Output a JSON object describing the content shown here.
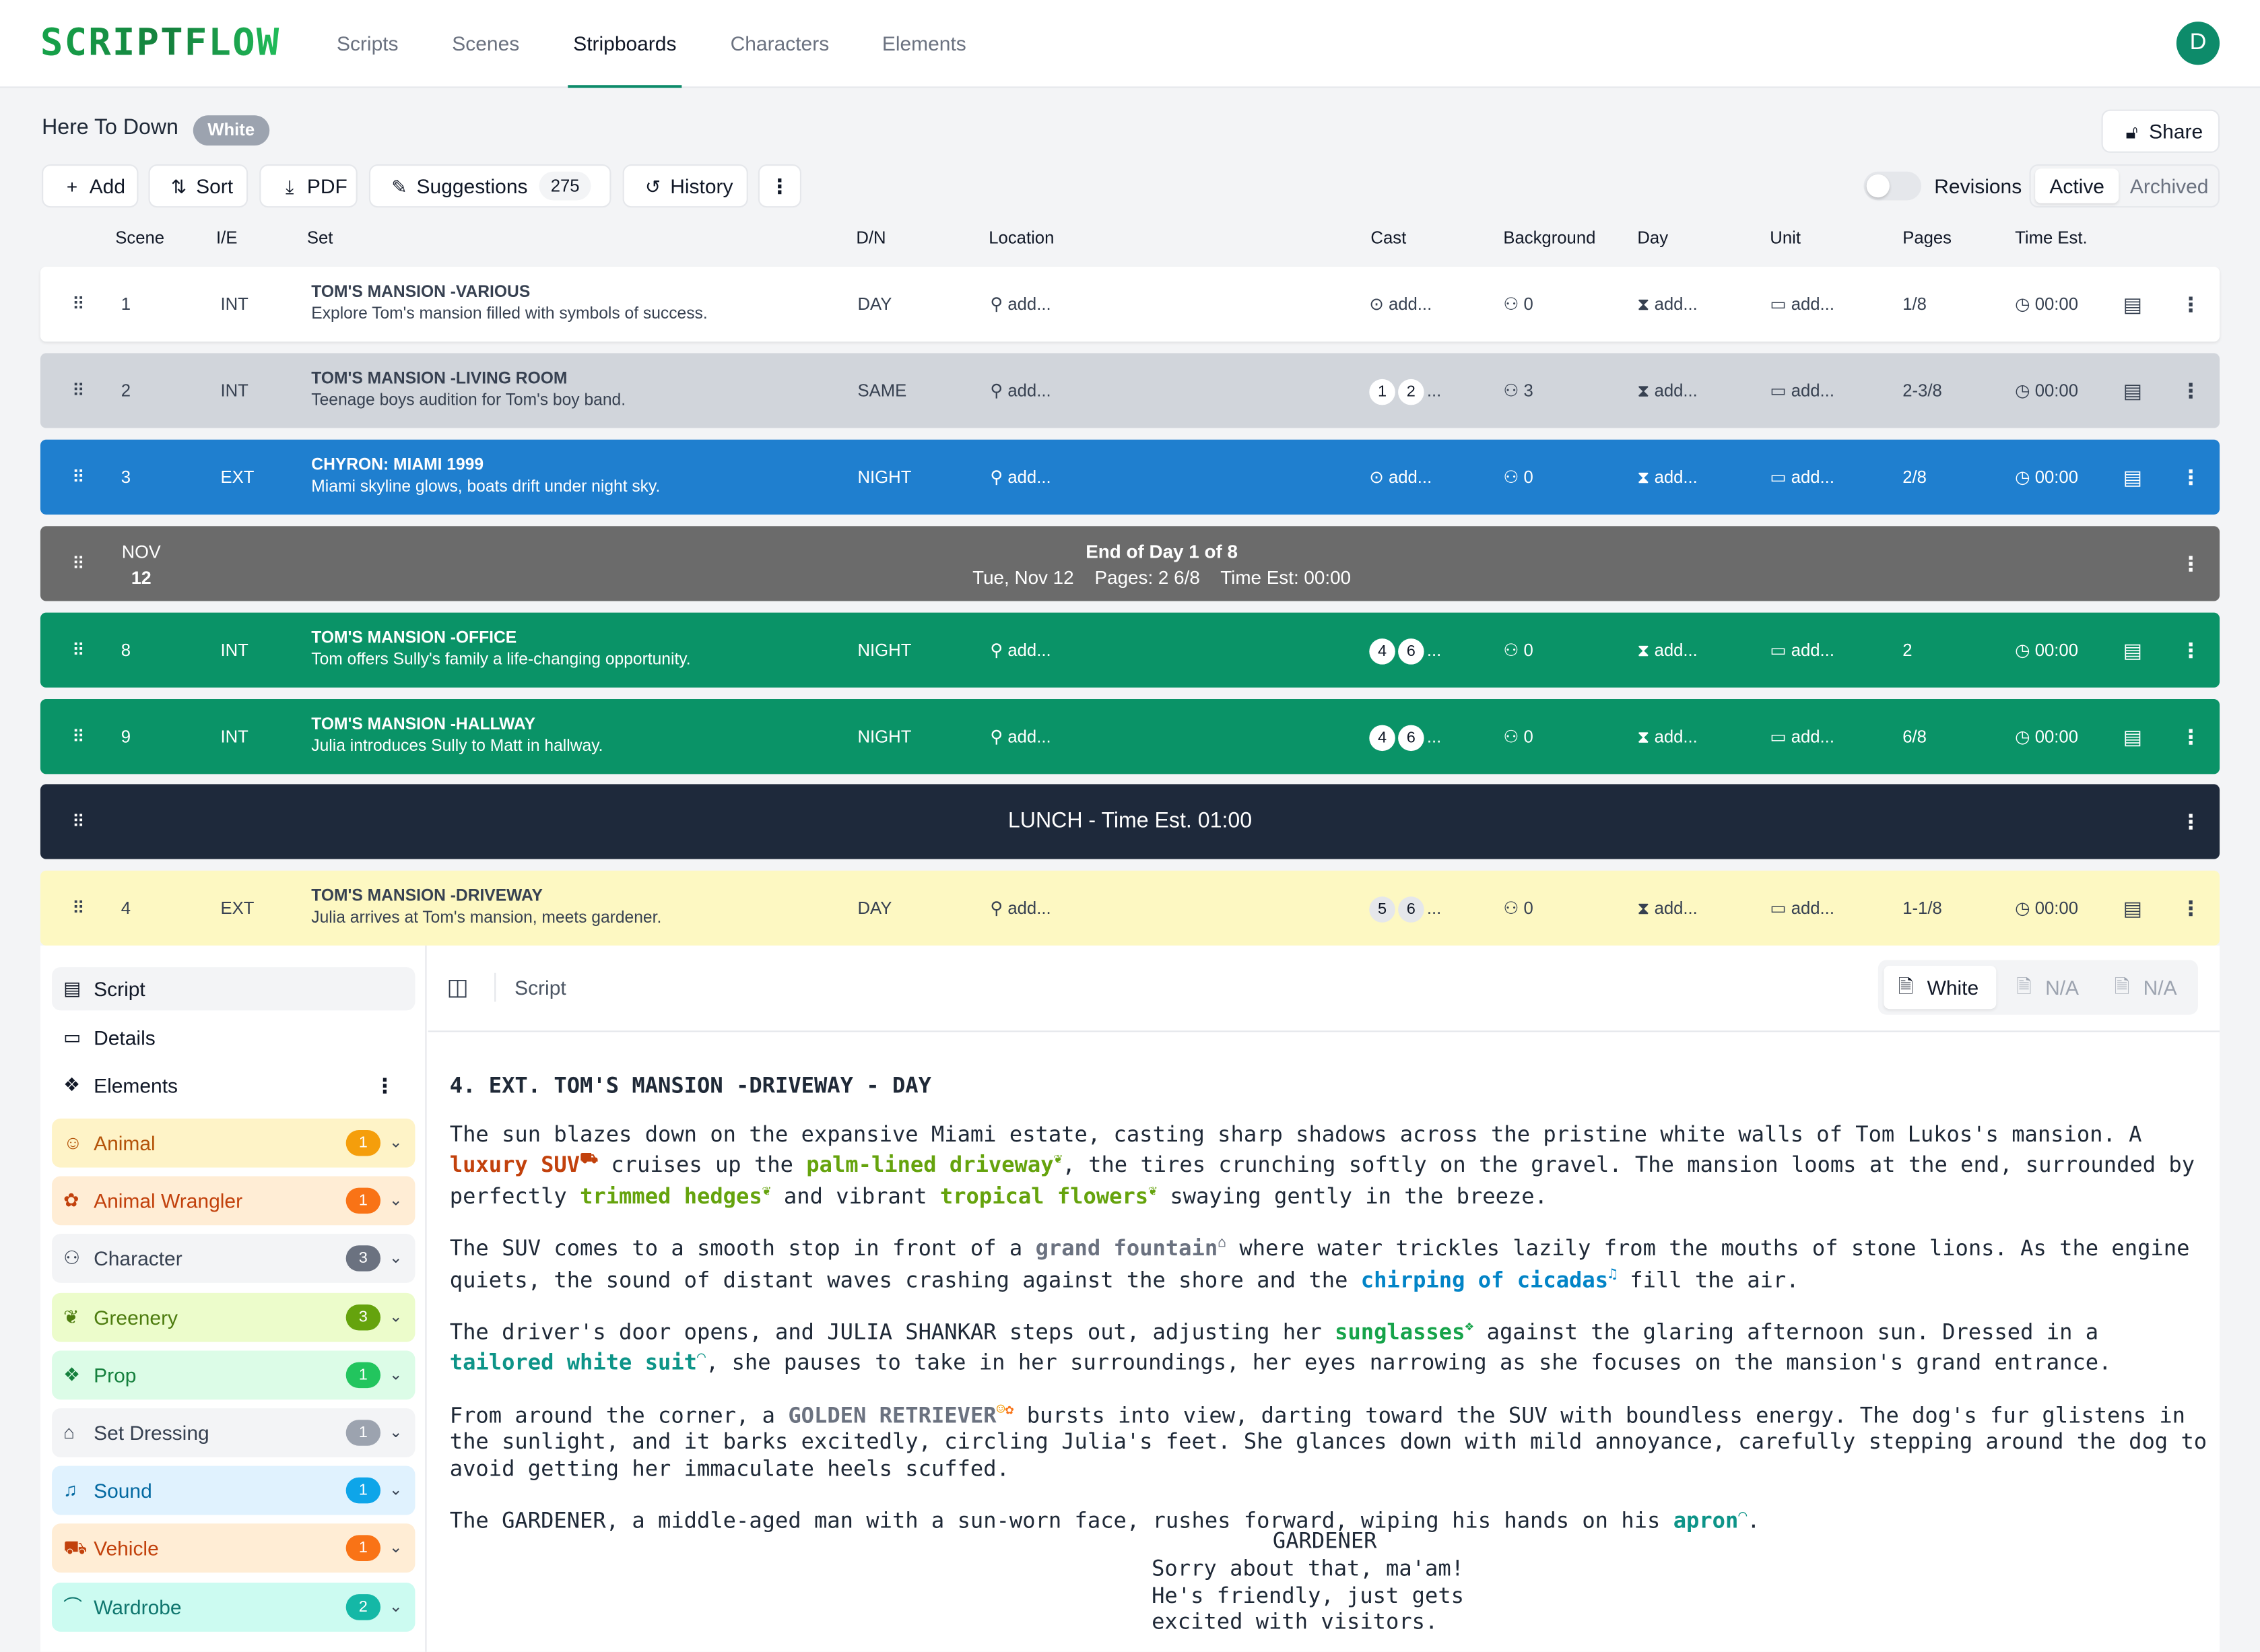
{
  "app": {
    "logo_text": "SCRIPTFLOW",
    "nav": [
      "Scripts",
      "Scenes",
      "Stripboards",
      "Characters",
      "Elements"
    ],
    "active_nav": "Stripboards",
    "avatar_initial": "D"
  },
  "doc": {
    "title": "Here To Down",
    "revision_badge": "White",
    "share_label": "Share"
  },
  "toolbar": {
    "add": "Add",
    "sort": "Sort",
    "pdf": "PDF",
    "suggestions": "Suggestions",
    "suggestions_count": "275",
    "history": "History",
    "revisions_label": "Revisions",
    "active": "Active",
    "archived": "Archived"
  },
  "columns": [
    "Scene",
    "I/E",
    "Set",
    "D/N",
    "Location",
    "Cast",
    "Background",
    "Day",
    "Unit",
    "Pages",
    "Time Est."
  ],
  "placeholders": {
    "location": "add...",
    "cast": "add...",
    "day": "add...",
    "unit": "add..."
  },
  "strips": [
    {
      "scene": "1",
      "ie": "INT",
      "set": "TOM'S MANSION -VARIOUS",
      "desc": "Explore Tom's mansion filled with symbols of success.",
      "dn": "DAY",
      "cast": [],
      "background": "0",
      "pages": "1/8",
      "time": "00:00",
      "color": "white"
    },
    {
      "scene": "2",
      "ie": "INT",
      "set": "TOM'S MANSION -LIVING ROOM",
      "desc": "Teenage boys audition for Tom's boy band.",
      "dn": "SAME",
      "cast": [
        "1",
        "2"
      ],
      "background": "3",
      "pages": "2-3/8",
      "time": "00:00",
      "color": "gray"
    },
    {
      "scene": "3",
      "ie": "EXT",
      "set": "CHYRON: MIAMI 1999",
      "desc": "Miami skyline glows, boats drift under night sky.",
      "dn": "NIGHT",
      "cast": [],
      "background": "0",
      "pages": "2/8",
      "time": "00:00",
      "color": "blue"
    },
    {
      "scene": "8",
      "ie": "INT",
      "set": "TOM'S MANSION -OFFICE",
      "desc": "Tom offers Sully's family a life-changing opportunity.",
      "dn": "NIGHT",
      "cast": [
        "4",
        "6"
      ],
      "background": "0",
      "pages": "2",
      "time": "00:00",
      "color": "green"
    },
    {
      "scene": "9",
      "ie": "INT",
      "set": "TOM'S MANSION -HALLWAY",
      "desc": "Julia introduces Sully to Matt in hallway.",
      "dn": "NIGHT",
      "cast": [
        "4",
        "6"
      ],
      "background": "0",
      "pages": "6/8",
      "time": "00:00",
      "color": "green"
    },
    {
      "scene": "4",
      "ie": "EXT",
      "set": "TOM'S MANSION -DRIVEWAY",
      "desc": "Julia arrives at Tom's mansion, meets gardener.",
      "dn": "DAY",
      "cast": [
        "5",
        "6"
      ],
      "background": "0",
      "pages": "1-1/8",
      "time": "00:00",
      "color": "yellow"
    }
  ],
  "day_break": {
    "month": "NOV",
    "day": "12",
    "title": "End of Day 1 of 8",
    "detail": "Tue, Nov 12    Pages: 2 6/8    Time Est: 00:00"
  },
  "lunch": {
    "label": "LUNCH - Time Est. 01:00"
  },
  "panel": {
    "tabs": [
      "Script",
      "Details",
      "Elements"
    ],
    "categories": [
      {
        "name": "Animal",
        "count": "1",
        "bg": "#fef3c7",
        "fg": "#b45309",
        "badge": "#f59e0b"
      },
      {
        "name": "Animal Wrangler",
        "count": "1",
        "bg": "#ffedd5",
        "fg": "#c2410c",
        "badge": "#f97316"
      },
      {
        "name": "Character",
        "count": "3",
        "bg": "#f3f4f6",
        "fg": "#374151",
        "badge": "#6b7280"
      },
      {
        "name": "Greenery",
        "count": "3",
        "bg": "#ecfccb",
        "fg": "#4d7c0f",
        "badge": "#65a30d"
      },
      {
        "name": "Prop",
        "count": "1",
        "bg": "#dcfce7",
        "fg": "#15803d",
        "badge": "#22c55e"
      },
      {
        "name": "Set Dressing",
        "count": "1",
        "bg": "#f3f4f6",
        "fg": "#374151",
        "badge": "#9ca3af"
      },
      {
        "name": "Sound",
        "count": "1",
        "bg": "#e0f2fe",
        "fg": "#0369a1",
        "badge": "#0ea5e9"
      },
      {
        "name": "Vehicle",
        "count": "1",
        "bg": "#ffedd5",
        "fg": "#c2410c",
        "badge": "#f97316"
      },
      {
        "name": "Wardrobe",
        "count": "2",
        "bg": "#ccfbf1",
        "fg": "#0f766e",
        "badge": "#14b8a6"
      }
    ],
    "script_label": "Script",
    "revisions": [
      "White",
      "N/A",
      "N/A"
    ]
  },
  "script": {
    "slug": "4. EXT. TOM'S MANSION -DRIVEWAY - DAY",
    "p1a": "The sun blazes down on the expansive Miami estate, casting sharp shadows across the pristine white walls of Tom Lukos's mansion. A ",
    "p1_el1": "luxury SUV",
    "p1b": " cruises up the ",
    "p1_el2": "palm-lined driveway",
    "p1c": ", the tires crunching softly on the gravel. The mansion looms at the end, surrounded by perfectly ",
    "p1_el3": "trimmed hedges",
    "p1d": " and vibrant ",
    "p1_el4": "tropical flowers",
    "p1e": " swaying gently in the breeze.",
    "p2a": "The SUV comes to a smooth stop in front of a ",
    "p2_el1": "grand fountain",
    "p2b": " where water trickles lazily from the mouths of stone lions. As the engine quiets, the sound of distant waves crashing against the shore and the ",
    "p2_el2": "chirping of cicadas",
    "p2c": " fill the air.",
    "p3a": "The driver's door opens, and JULIA SHANKAR steps out, adjusting her ",
    "p3_el1": "sunglasses",
    "p3b": " against the glaring afternoon sun. Dressed in a ",
    "p3_el2": "tailored white suit",
    "p3c": ", she pauses to take in her surroundings, her eyes narrowing as she focuses on the mansion's grand entrance.",
    "p4a": "From around the corner, a ",
    "p4_el1": "GOLDEN RETRIEVER",
    "p4b": " bursts into view, darting toward the SUV with boundless energy. The dog's fur glistens in the sunlight, and it barks excitedly, circling Julia's feet. She glances down with mild annoyance, carefully stepping around the dog to avoid getting her immaculate heels scuffed.",
    "p5a": "The GARDENER, a middle-aged man with a sun-worn face, rushes forward, wiping his hands on his ",
    "p5_el1": "apron",
    "p5b": ".",
    "dialogue_character": "GARDENER",
    "dialogue_lines": "Sorry about that, ma'am!\nHe's friendly, just gets\nexcited with visitors."
  }
}
